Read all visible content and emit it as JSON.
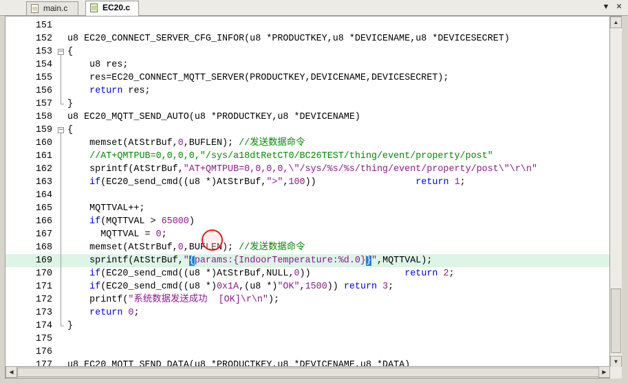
{
  "tabs": [
    {
      "label": "main.c",
      "active": false,
      "icon": "c-file-icon"
    },
    {
      "label": "EC20.c",
      "active": true,
      "icon": "c-file-icon"
    }
  ],
  "tab_controls": {
    "dropdown": "▼",
    "close": "✕"
  },
  "lines": [
    {
      "n": "151",
      "segs": []
    },
    {
      "n": "152",
      "segs": [
        [
          "n",
          "u8 EC20_CONNECT_SERVER_CFG_INFOR(u8 *PRODUCTKEY,u8 *DEVICENAME,u8 *DEVICESECRET)"
        ]
      ]
    },
    {
      "n": "153",
      "segs": [
        [
          "n",
          "{"
        ]
      ]
    },
    {
      "n": "154",
      "segs": [
        [
          "n",
          "    u8 res;"
        ]
      ]
    },
    {
      "n": "155",
      "segs": [
        [
          "n",
          "    res=EC20_CONNECT_MQTT_SERVER(PRODUCTKEY,DEVICENAME,DEVICESECRET);"
        ]
      ]
    },
    {
      "n": "156",
      "segs": [
        [
          "n",
          "    "
        ],
        [
          "k",
          "return"
        ],
        [
          "n",
          " res;"
        ]
      ]
    },
    {
      "n": "157",
      "segs": [
        [
          "n",
          "}"
        ]
      ]
    },
    {
      "n": "158",
      "segs": [
        [
          "n",
          "u8 EC20_MQTT_SEND_AUTO(u8 *PRODUCTKEY,u8 *DEVICENAME)"
        ]
      ]
    },
    {
      "n": "159",
      "segs": [
        [
          "n",
          "{"
        ]
      ]
    },
    {
      "n": "160",
      "segs": [
        [
          "n",
          "    memset(AtStrBuf,"
        ],
        [
          "c",
          "0"
        ],
        [
          "n",
          ",BUFLEN); "
        ],
        [
          "m",
          "//发送数据命令"
        ]
      ]
    },
    {
      "n": "161",
      "segs": [
        [
          "n",
          "    "
        ],
        [
          "m",
          "//AT+QMTPUB=0,0,0,0,\"/sys/a18dtRetCT0/BC26TEST/thing/event/property/post\""
        ]
      ]
    },
    {
      "n": "162",
      "segs": [
        [
          "n",
          "    sprintf(AtStrBuf,"
        ],
        [
          "s",
          "\"AT+QMTPUB=0,0,0,0,\\\"/sys/%s/%s/thing/event/property/post\\\"\\r\\n\""
        ]
      ]
    },
    {
      "n": "163",
      "segs": [
        [
          "n",
          "    "
        ],
        [
          "k",
          "if"
        ],
        [
          "n",
          "(EC20_send_cmd((u8 *)AtStrBuf,"
        ],
        [
          "s",
          "\">\""
        ],
        [
          "n",
          ","
        ],
        [
          "c",
          "100"
        ],
        [
          "n",
          "))                  "
        ],
        [
          "k",
          "return"
        ],
        [
          "n",
          " "
        ],
        [
          "c",
          "1"
        ],
        [
          "n",
          ";"
        ]
      ]
    },
    {
      "n": "164",
      "segs": []
    },
    {
      "n": "165",
      "segs": [
        [
          "n",
          "    MQTTVAL++;"
        ]
      ]
    },
    {
      "n": "166",
      "segs": [
        [
          "n",
          "    "
        ],
        [
          "k",
          "if"
        ],
        [
          "n",
          "(MQTTVAL > "
        ],
        [
          "c",
          "65000"
        ],
        [
          "n",
          ")"
        ]
      ]
    },
    {
      "n": "167",
      "segs": [
        [
          "n",
          "      MQTTVAL = "
        ],
        [
          "c",
          "0"
        ],
        [
          "n",
          ";"
        ]
      ]
    },
    {
      "n": "168",
      "segs": [
        [
          "n",
          "    memset(AtStrBuf,"
        ],
        [
          "c",
          "0"
        ],
        [
          "n",
          ",BUFLEN); "
        ],
        [
          "m",
          "//发送数据命令"
        ]
      ]
    },
    {
      "n": "169",
      "segs": [
        [
          "n",
          "    sprintf(AtStrBuf,"
        ],
        [
          "s",
          "\""
        ],
        [
          "b",
          "{"
        ],
        [
          "s",
          "params:{IndoorTemperature:%d.0}"
        ],
        [
          "b",
          "}"
        ],
        [
          "s",
          "\""
        ],
        [
          "n",
          ",MQTTVAL);"
        ]
      ],
      "hl": true
    },
    {
      "n": "170",
      "segs": [
        [
          "n",
          "    "
        ],
        [
          "k",
          "if"
        ],
        [
          "n",
          "(EC20_send_cmd((u8 *)AtStrBuf,NULL,"
        ],
        [
          "c",
          "0"
        ],
        [
          "n",
          "))                 "
        ],
        [
          "k",
          "return"
        ],
        [
          "n",
          " "
        ],
        [
          "c",
          "2"
        ],
        [
          "n",
          ";"
        ]
      ]
    },
    {
      "n": "171",
      "segs": [
        [
          "n",
          "    "
        ],
        [
          "k",
          "if"
        ],
        [
          "n",
          "(EC20_send_cmd((u8 *)"
        ],
        [
          "c",
          "0x1A"
        ],
        [
          "n",
          ",(u8 *)"
        ],
        [
          "s",
          "\"OK\""
        ],
        [
          "n",
          ","
        ],
        [
          "c",
          "1500"
        ],
        [
          "n",
          ")) "
        ],
        [
          "k",
          "return"
        ],
        [
          "n",
          " "
        ],
        [
          "c",
          "3"
        ],
        [
          "n",
          ";"
        ]
      ]
    },
    {
      "n": "172",
      "segs": [
        [
          "n",
          "    printf("
        ],
        [
          "s",
          "\"系统数据发送成功  [OK]\\r\\n\""
        ],
        [
          "n",
          ");"
        ]
      ]
    },
    {
      "n": "173",
      "segs": [
        [
          "n",
          "    "
        ],
        [
          "k",
          "return"
        ],
        [
          "n",
          " "
        ],
        [
          "c",
          "0"
        ],
        [
          "n",
          ";"
        ]
      ]
    },
    {
      "n": "174",
      "segs": [
        [
          "n",
          "}"
        ]
      ]
    },
    {
      "n": "175",
      "segs": []
    },
    {
      "n": "176",
      "segs": []
    },
    {
      "n": "177",
      "segs": [
        [
          "n",
          "u8 EC20_MQTT_SEND_DATA(u8 *PRODUCTKEY,u8 *DEVICENAME,u8 *DATA)"
        ]
      ]
    }
  ],
  "colors": {
    "keyword": "#0000e6",
    "comment": "#008a00",
    "string": "#8b1a8b",
    "number": "#8b1a8b",
    "highlight_line": "#dcf5e6",
    "brace_match": "#2a7bd6"
  }
}
